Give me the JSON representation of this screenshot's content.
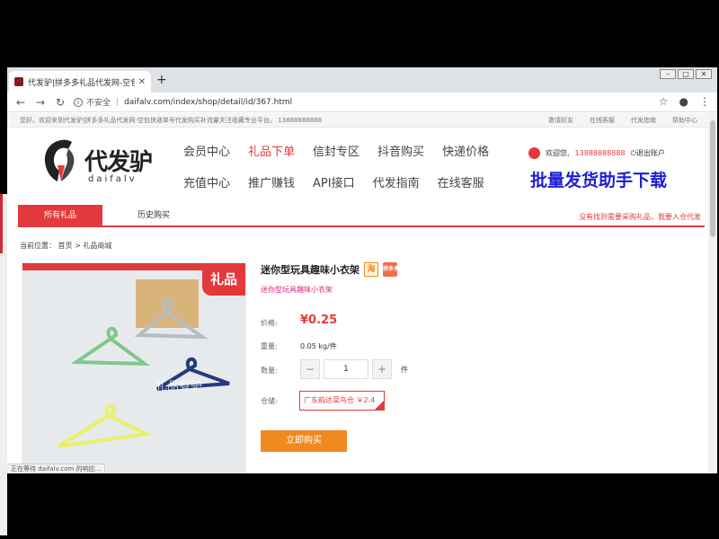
{
  "browser": {
    "tab_title": "代发驴|拼多多礼品代发网-空包快递",
    "url_security": "不安全",
    "url": "daifalv.com/index/shop/detail/id/367.html"
  },
  "topbar": {
    "welcome": "您好。欢迎来到代发驴|拼多多礼品代发网-空包快递单号代发购买补流量关注收藏专业平台。 13888888888",
    "links": [
      "邀请好友",
      "在线客服",
      "代发指南",
      "帮助中心"
    ]
  },
  "logo": {
    "brand": "代发驴",
    "brand_en": "daifalv"
  },
  "nav": {
    "row1": [
      "会员中心",
      "礼品下单",
      "信封专区",
      "抖音购买",
      "快递价格"
    ],
    "row2": [
      "充值中心",
      "推广赚钱",
      "API接口",
      "代发指南",
      "在线客服"
    ]
  },
  "user": {
    "greeting": "欢迎您,",
    "phone": "13888888888",
    "logout": "退出账户"
  },
  "promo": "批量发货助手下载",
  "subtabs": {
    "tab1": "所有礼品",
    "tab2": "历史购买",
    "note": "没有找到需要采购礼品，我要入仓代发"
  },
  "breadcrumb": "当前位置： 首页 > 礼品商城",
  "product": {
    "image_corner": "礼品",
    "watermark": "礼品有驴",
    "title": "迷你型玩具趣味小衣架",
    "badge_taobao": "淘",
    "badge_pdd": "拼多多",
    "subtitle": "迷你型玩具趣味小衣架",
    "price_label": "价格:",
    "price": "¥0.25",
    "weight_label": "重量:",
    "weight": "0.05 kg/件",
    "qty_label": "数量:",
    "qty_minus": "−",
    "qty_value": "1",
    "qty_plus": "+",
    "qty_unit": "件",
    "store_label": "仓储:",
    "store": "广东韵达菜鸟仓 ￥2.4",
    "buy_button": "立即购买"
  },
  "status_text": "正在等待 daifalv.com 的响应..."
}
